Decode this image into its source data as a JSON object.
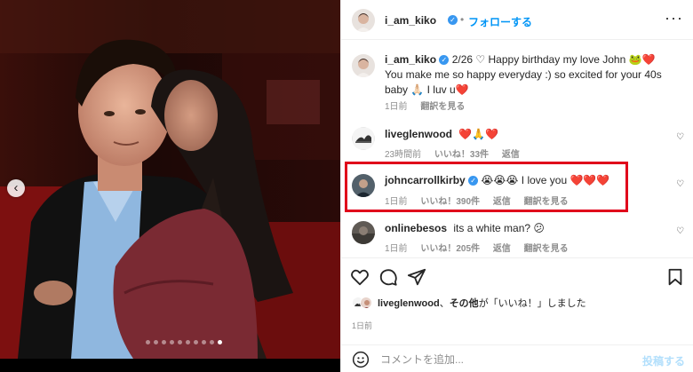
{
  "post": {
    "author": "i_am_kiko",
    "follow_label": "フォローする",
    "separator": "•",
    "more_label": "···"
  },
  "caption": {
    "username": "i_am_kiko",
    "text": "2/26 ♡ Happy birthday my love John 🐸❤️",
    "text2": "You make me so happy everyday :) so excited for your 40s baby 🙏🏻 I luv u❤️",
    "time": "1日前",
    "translate": "翻訳を見る"
  },
  "comments": [
    {
      "username": "liveglenwood",
      "text": "❤️🙏❤️",
      "time": "23時間前",
      "likes": "いいね！33件",
      "reply": "返信"
    },
    {
      "username": "johncarrollkirby",
      "text": "😭😭😭 I love you ❤️❤️❤️",
      "time": "1日前",
      "likes": "いいね！390件",
      "reply": "返信",
      "translate": "翻訳を見る"
    },
    {
      "username": "onlinebesos",
      "text": "its a white man? 😕",
      "time": "1日前",
      "likes": "いいね！205件",
      "reply": "返信",
      "translate": "翻訳を見る"
    }
  ],
  "likes": {
    "user": "liveglenwood",
    "connector": "、",
    "others": "その他",
    "suffix": "が「いいね！」しました"
  },
  "time_ago": "1日前",
  "comment_box": {
    "placeholder": "コメントを追加...",
    "post_label": "投稿する"
  },
  "carousel": {
    "total": 10,
    "active": 9
  },
  "icons": [
    "heart-icon",
    "comment-icon",
    "share-icon",
    "bookmark-icon",
    "emoji-icon",
    "verified-icon",
    "chevron-left-icon",
    "more-icon"
  ],
  "colors": {
    "accent": "#0095f6",
    "verified": "#3897f0",
    "highlight": "#e0001b",
    "post_disabled": "#b2dffc"
  }
}
